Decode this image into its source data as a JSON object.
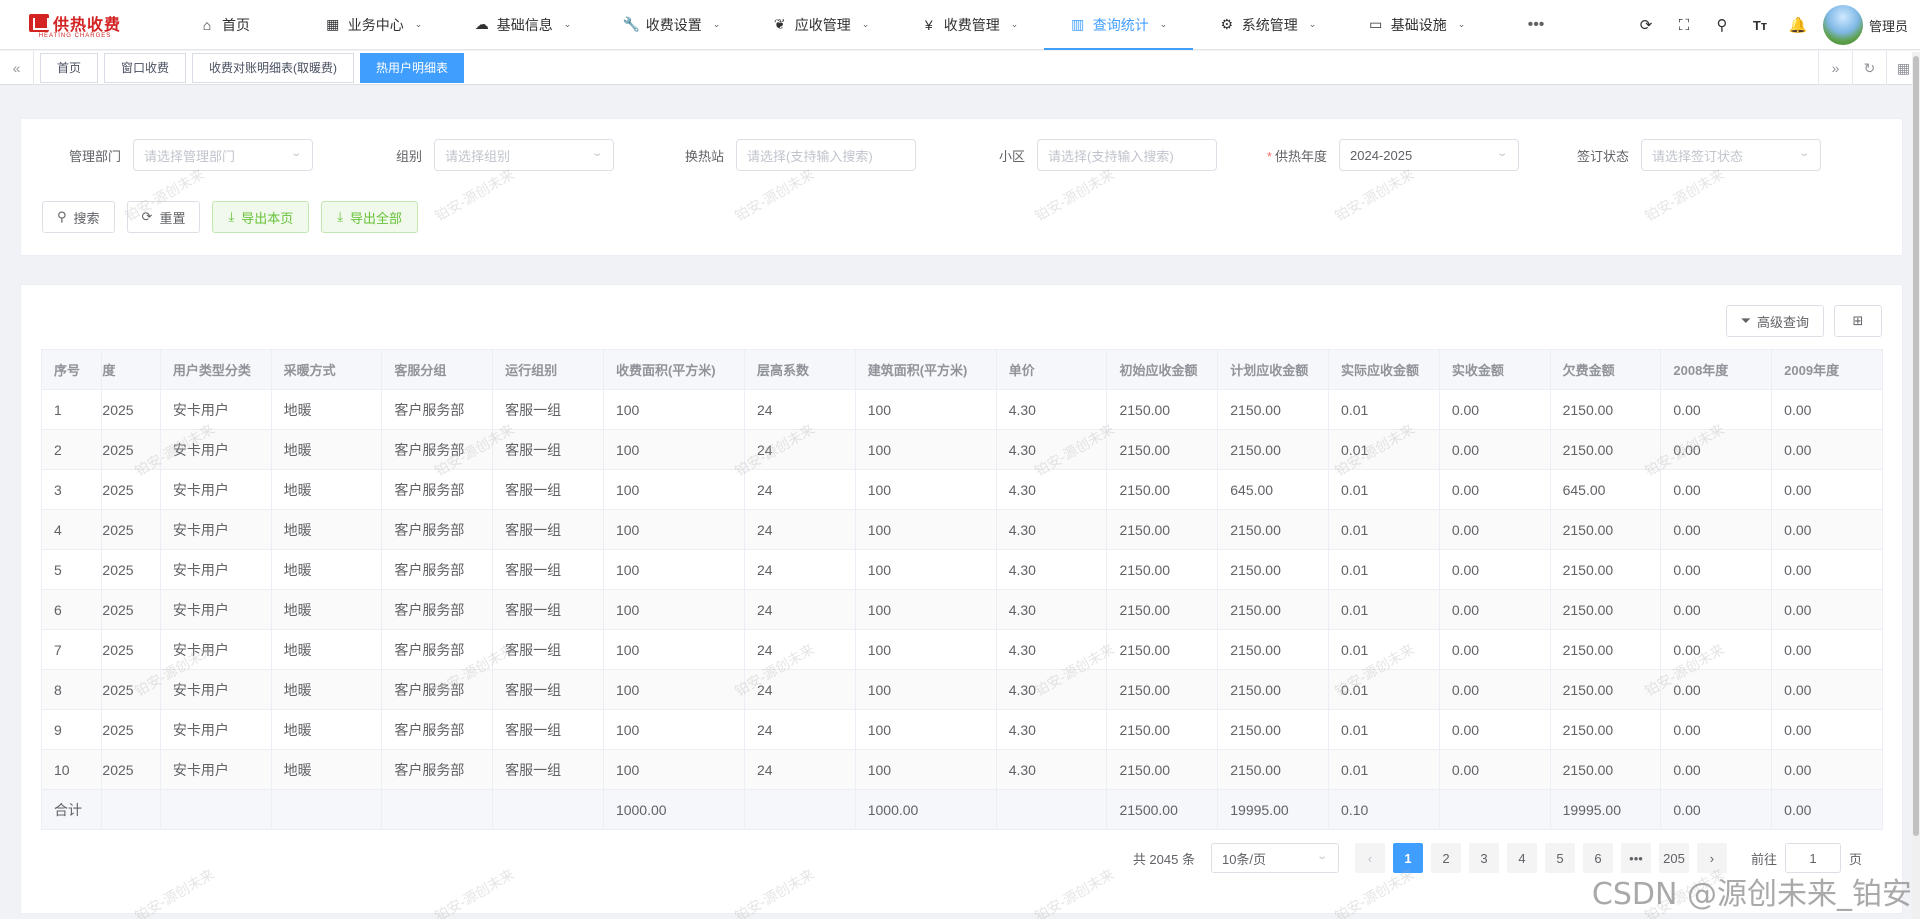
{
  "brand": {
    "name": "供热收费",
    "sub": "HEATING CHARGES"
  },
  "menu": [
    {
      "label": "首页",
      "icon": "home-icon",
      "glyph": "⌂",
      "chevron": false
    },
    {
      "label": "业务中心",
      "icon": "grid-icon",
      "glyph": "▦",
      "chevron": true
    },
    {
      "label": "基础信息",
      "icon": "cloud-icon",
      "glyph": "☁",
      "chevron": true
    },
    {
      "label": "收费设置",
      "icon": "wrench-icon",
      "glyph": "🔧",
      "chevron": true
    },
    {
      "label": "应收管理",
      "icon": "leaf-icon",
      "glyph": "❦",
      "chevron": true
    },
    {
      "label": "收费管理",
      "icon": "yen-icon",
      "glyph": "¥",
      "chevron": true
    },
    {
      "label": "查询统计",
      "icon": "chart-icon",
      "glyph": "▥",
      "chevron": true,
      "active": true
    },
    {
      "label": "系统管理",
      "icon": "gear-icon",
      "glyph": "⚙",
      "chevron": true
    },
    {
      "label": "基础设施",
      "icon": "monitor-icon",
      "glyph": "▭",
      "chevron": true
    }
  ],
  "user": {
    "name": "管理员"
  },
  "tabs": [
    "首页",
    "窗口收费",
    "收费对账明细表(取暖费)",
    "热用户明细表"
  ],
  "filters": {
    "dept": {
      "label": "管理部门",
      "placeholder": "请选择管理部门"
    },
    "group": {
      "label": "组别",
      "placeholder": "请选择组别"
    },
    "station": {
      "label": "换热站",
      "placeholder": "请选择(支持输入搜索)"
    },
    "community": {
      "label": "小区",
      "placeholder": "请选择(支持输入搜索)"
    },
    "year": {
      "label": "供热年度",
      "value": "2024-2025",
      "required": true
    },
    "sign": {
      "label": "签订状态",
      "placeholder": "请选择签订状态"
    }
  },
  "buttons": {
    "search": "搜索",
    "reset": "重置",
    "export_page": "导出本页",
    "export_all": "导出全部",
    "advanced": "高级查询"
  },
  "table": {
    "headers": [
      "序号",
      "度",
      "用户类型分类",
      "采暖方式",
      "客服分组",
      "运行组别",
      "收费面积(平方米)",
      "层高系数",
      "建筑面积(平方米)",
      "单价",
      "初始应收金额",
      "计划应收金额",
      "实际应收金额",
      "实收金额",
      "欠费金额",
      "2008年度",
      "2009年度"
    ],
    "rows": [
      [
        "1",
        "2025",
        "安卡用户",
        "地暖",
        "客户服务部",
        "客服一组",
        "100",
        "24",
        "100",
        "4.30",
        "2150.00",
        "2150.00",
        "0.01",
        "0.00",
        "2150.00",
        "0.00",
        "0.00"
      ],
      [
        "2",
        "2025",
        "安卡用户",
        "地暖",
        "客户服务部",
        "客服一组",
        "100",
        "24",
        "100",
        "4.30",
        "2150.00",
        "2150.00",
        "0.01",
        "0.00",
        "2150.00",
        "0.00",
        "0.00"
      ],
      [
        "3",
        "2025",
        "安卡用户",
        "地暖",
        "客户服务部",
        "客服一组",
        "100",
        "24",
        "100",
        "4.30",
        "2150.00",
        "645.00",
        "0.01",
        "0.00",
        "645.00",
        "0.00",
        "0.00"
      ],
      [
        "4",
        "2025",
        "安卡用户",
        "地暖",
        "客户服务部",
        "客服一组",
        "100",
        "24",
        "100",
        "4.30",
        "2150.00",
        "2150.00",
        "0.01",
        "0.00",
        "2150.00",
        "0.00",
        "0.00"
      ],
      [
        "5",
        "2025",
        "安卡用户",
        "地暖",
        "客户服务部",
        "客服一组",
        "100",
        "24",
        "100",
        "4.30",
        "2150.00",
        "2150.00",
        "0.01",
        "0.00",
        "2150.00",
        "0.00",
        "0.00"
      ],
      [
        "6",
        "2025",
        "安卡用户",
        "地暖",
        "客户服务部",
        "客服一组",
        "100",
        "24",
        "100",
        "4.30",
        "2150.00",
        "2150.00",
        "0.01",
        "0.00",
        "2150.00",
        "0.00",
        "0.00"
      ],
      [
        "7",
        "2025",
        "安卡用户",
        "地暖",
        "客户服务部",
        "客服一组",
        "100",
        "24",
        "100",
        "4.30",
        "2150.00",
        "2150.00",
        "0.01",
        "0.00",
        "2150.00",
        "0.00",
        "0.00"
      ],
      [
        "8",
        "2025",
        "安卡用户",
        "地暖",
        "客户服务部",
        "客服一组",
        "100",
        "24",
        "100",
        "4.30",
        "2150.00",
        "2150.00",
        "0.01",
        "0.00",
        "2150.00",
        "0.00",
        "0.00"
      ],
      [
        "9",
        "2025",
        "安卡用户",
        "地暖",
        "客户服务部",
        "客服一组",
        "100",
        "24",
        "100",
        "4.30",
        "2150.00",
        "2150.00",
        "0.01",
        "0.00",
        "2150.00",
        "0.00",
        "0.00"
      ],
      [
        "10",
        "2025",
        "安卡用户",
        "地暖",
        "客户服务部",
        "客服一组",
        "100",
        "24",
        "100",
        "4.30",
        "2150.00",
        "2150.00",
        "0.01",
        "0.00",
        "2150.00",
        "0.00",
        "0.00"
      ]
    ],
    "summary": [
      "合计",
      "",
      "",
      "",
      "",
      "",
      "1000.00",
      "",
      "1000.00",
      "",
      "21500.00",
      "19995.00",
      "0.10",
      "",
      "19995.00",
      "0.00",
      "0.00"
    ]
  },
  "pagination": {
    "total": "共 2045 条",
    "page_size": "10条/页",
    "prev": "‹",
    "next": "›",
    "pages": [
      "1",
      "2",
      "3",
      "4",
      "5",
      "6",
      "•••",
      "205"
    ],
    "current": "1",
    "goto_label": "前往",
    "goto_value": "1",
    "goto_suffix": "页"
  },
  "watermark": "铂安-源创未来",
  "csdn": "CSDN @源创未来_铂安",
  "colors": {
    "primary": "#409eff",
    "success": "#67c23a",
    "brand_red": "#d32323"
  }
}
